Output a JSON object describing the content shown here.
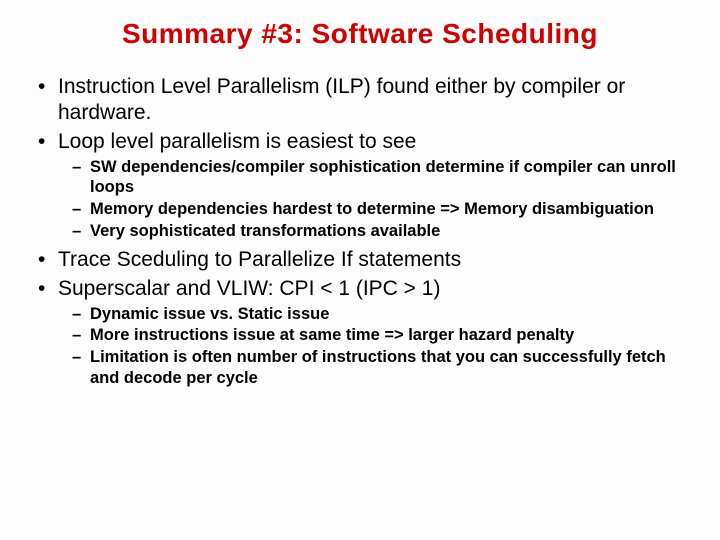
{
  "title": "Summary #3: Software Scheduling",
  "bullets": [
    {
      "text": "Instruction Level Parallelism (ILP) found either by compiler or hardware."
    },
    {
      "text": "Loop level parallelism is easiest to see",
      "sub": [
        "SW dependencies/compiler sophistication determine if compiler can unroll loops",
        "Memory dependencies hardest to determine => Memory disambiguation",
        "Very sophisticated transformations available"
      ]
    },
    {
      "text": "Trace Sceduling to Parallelize If statements"
    },
    {
      "text": "Superscalar and VLIW: CPI < 1 (IPC > 1)",
      "sub": [
        "Dynamic issue vs. Static issue",
        "More instructions issue at same time => larger hazard penalty",
        "Limitation is often number of instructions that you can successfully fetch and decode per cycle"
      ]
    }
  ]
}
